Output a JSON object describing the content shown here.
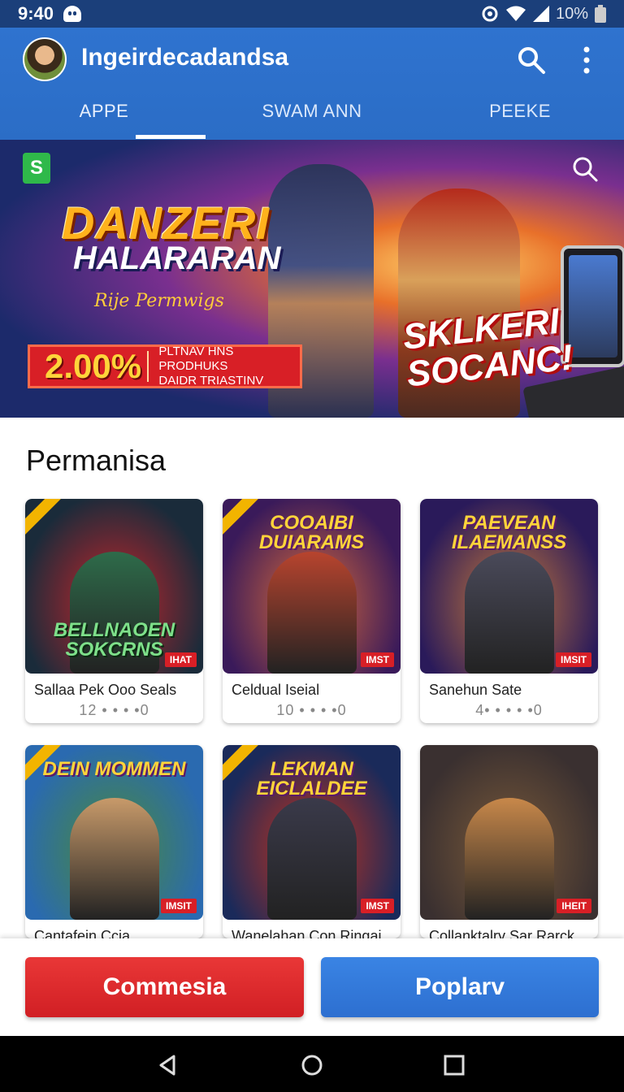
{
  "status_bar": {
    "time": "9:40",
    "battery": "10%"
  },
  "app_bar": {
    "title": "Ingeirdecadandsa"
  },
  "tabs": [
    {
      "label": "APPE"
    },
    {
      "label": "SWAM ANN"
    },
    {
      "label": "PEEKE"
    }
  ],
  "banner": {
    "title_line1": "DANZERI",
    "title_line2": "HALARARAN",
    "subtitle": "Rije Permwigs",
    "promo_percent": "2.00%",
    "promo_line1": "PLTNAV HNS PRODHUKS",
    "promo_line2": "DAIDR TRIASTINV",
    "cta_line1": "SKLKERI",
    "cta_line2": "SOCANC!"
  },
  "section": {
    "title": "Permanisa"
  },
  "games": [
    {
      "art_title": "BELLNAOEN SOKCRNS",
      "tag": "IHAT",
      "name": "Sallaa Pek Ooo Seals",
      "rating": "12 • • • •0",
      "colors": [
        "#1a2b3a",
        "#c8242a"
      ],
      "figure": "#2e6b4a"
    },
    {
      "art_title": "COOAIBI DUIARAMS",
      "tag": "IMST",
      "name": "Celdual Iseial",
      "rating": "10 • • • •0",
      "colors": [
        "#3a1a5a",
        "#d86a3a"
      ],
      "figure": "#b8442e"
    },
    {
      "art_title": "PAEVEAN ILAEMANSS",
      "tag": "IMSIT",
      "name": "Sanehun Sate",
      "rating": "4• • • • •0",
      "colors": [
        "#2a1a5a",
        "#c87a3a"
      ],
      "figure": "#4a4a5a"
    },
    {
      "art_title": "DEIN MOMMEN",
      "tag": "IMSIT",
      "name": "Cantafein Ccia",
      "rating": "",
      "colors": [
        "#2a6ab0",
        "#4a8a3a"
      ],
      "figure": "#c89a6a"
    },
    {
      "art_title": "LEKMAN EICLALDEE",
      "tag": "IMST",
      "name": "Wanelahan Con Ringai",
      "rating": "",
      "colors": [
        "#1a2a5a",
        "#c8321a"
      ],
      "figure": "#3a3a4a"
    },
    {
      "art_title": "",
      "tag": "IHEIT",
      "name": "Collanktalry Sar Rarck",
      "rating": "",
      "colors": [
        "#3a3030",
        "#7a5a3a"
      ],
      "figure": "#c8884a"
    }
  ],
  "actions": {
    "left_label": "Commesia",
    "right_label": "Poplarv"
  }
}
